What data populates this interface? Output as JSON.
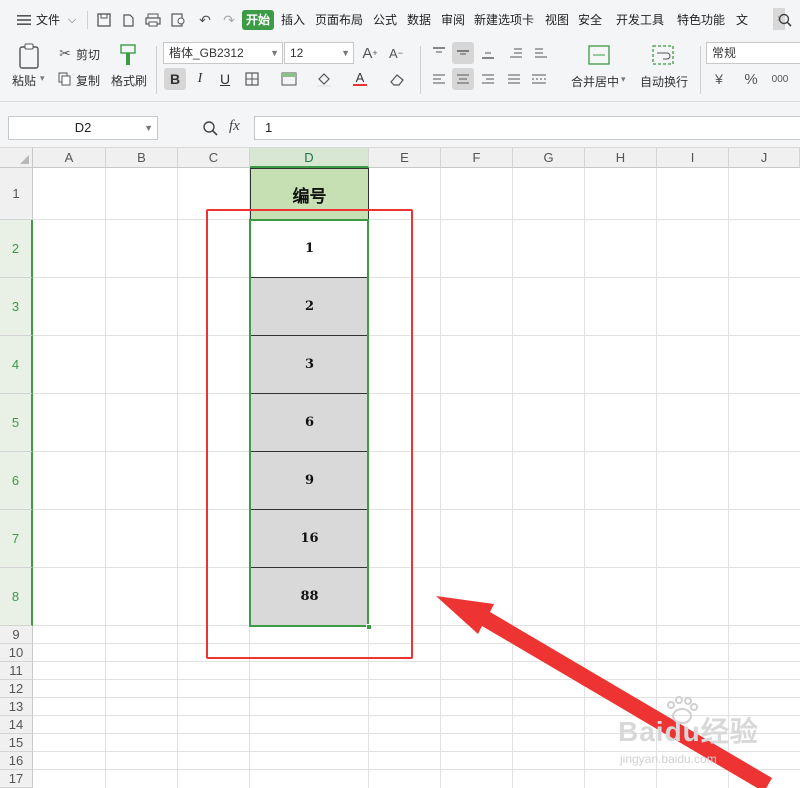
{
  "menubar": {
    "file_label": "文件",
    "tabs": [
      {
        "label": "开始",
        "active": true
      },
      {
        "label": "插入"
      },
      {
        "label": "页面布局"
      },
      {
        "label": "公式"
      },
      {
        "label": "数据"
      },
      {
        "label": "审阅"
      },
      {
        "label": "新建选项卡"
      },
      {
        "label": "视图"
      },
      {
        "label": "安全"
      },
      {
        "label": "开发工具"
      },
      {
        "label": "特色功能"
      },
      {
        "label": "文"
      }
    ]
  },
  "ribbon": {
    "paste": "粘贴",
    "cut": "剪切",
    "copy": "复制",
    "format_painter": "格式刷",
    "font_name": "楷体_GB2312",
    "font_size": "12",
    "merge_center": "合并居中",
    "wrap_text": "自动换行",
    "number_format": "常规"
  },
  "formula_bar": {
    "cell_ref": "D2",
    "fx_label": "fx",
    "value": "1"
  },
  "sheet": {
    "columns": [
      "A",
      "B",
      "C",
      "D",
      "E",
      "F",
      "G",
      "H",
      "I",
      "J"
    ],
    "rows": [
      "1",
      "2",
      "3",
      "4",
      "5",
      "6",
      "7",
      "8",
      "9",
      "10",
      "11",
      "12",
      "13",
      "14",
      "15",
      "16",
      "17"
    ],
    "header_cell": "编号",
    "values": [
      "1",
      "2",
      "3",
      "6",
      "9",
      "16",
      "88"
    ]
  },
  "watermark": {
    "text": "Baidu经验",
    "url": "jingyan.baidu.com"
  },
  "colors": {
    "accent_green": "#3c9b44",
    "header_fill": "#c6e0b4",
    "cell_fill": "#d9d9d9",
    "annotation_red": "#e33333"
  }
}
